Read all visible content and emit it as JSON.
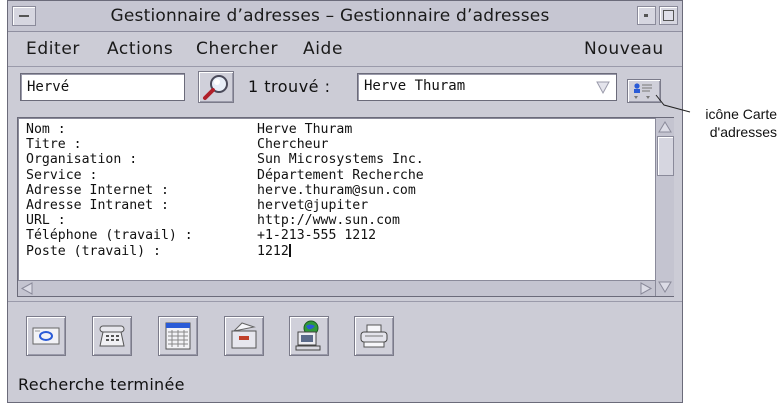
{
  "window": {
    "title": "Gestionnaire d’adresses – Gestionnaire d’adresses"
  },
  "menubar": {
    "items": [
      "Editer",
      "Actions",
      "Chercher",
      "Aide"
    ],
    "right_item": "Nouveau"
  },
  "search": {
    "input_value": "Hervé",
    "found_label": "1 trouvé :",
    "result_value": "Herve Thuram"
  },
  "card": {
    "fields": [
      {
        "label": "Nom :",
        "value": "Herve Thuram"
      },
      {
        "label": "Titre :",
        "value": "Chercheur"
      },
      {
        "label": "Organisation :",
        "value": "Sun Microsystems Inc."
      },
      {
        "label": "Service :",
        "value": "Département Recherche"
      },
      {
        "label": "Adresse Internet :",
        "value": "herve.thuram@sun.com"
      },
      {
        "label": "Adresse Intranet :",
        "value": "hervet@jupiter"
      },
      {
        "label": "URL :",
        "value": "http://www.sun.com"
      },
      {
        "label": "Téléphone (travail) :",
        "value": "+1-213-555 1212"
      },
      {
        "label": "Poste (travail) :",
        "value": "1212"
      }
    ]
  },
  "toolbar": {
    "icons": [
      "mail-icon",
      "phone-icon",
      "calendar-icon",
      "card-file-icon",
      "web-terminal-icon",
      "printer-icon"
    ]
  },
  "status": "Recherche terminée",
  "annotation": {
    "line1": "icône Carte",
    "line2": "d'adresses"
  },
  "colors": {
    "window_bg": "#ccccd6",
    "accent_blue": "#2a5bd7",
    "search_icon_red": "#b0202a"
  }
}
